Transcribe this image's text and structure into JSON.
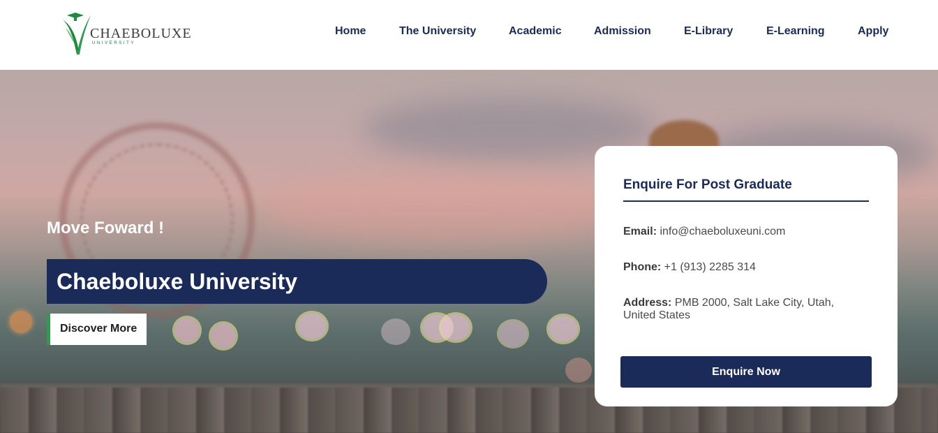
{
  "brand": {
    "name": "CHAEBOLUXE",
    "tagline": "UNIVERSITY",
    "primary_color": "#1b2b59",
    "accent_color": "#2e9b4f"
  },
  "nav": {
    "items": [
      {
        "label": "Home"
      },
      {
        "label": "The University"
      },
      {
        "label": "Academic"
      },
      {
        "label": "Admission"
      },
      {
        "label": "E-Library"
      },
      {
        "label": "E-Learning"
      },
      {
        "label": "Apply"
      }
    ]
  },
  "hero": {
    "eyebrow": "Move Foward !",
    "title": "Chaeboluxe University",
    "cta_label": "Discover More"
  },
  "enquiry": {
    "title": "Enquire For Post Graduate",
    "email_label": "Email:",
    "email_value": "info@chaeboluxeuni.com",
    "phone_label": "Phone:",
    "phone_value": "+1 (913) 2285 314",
    "address_label": "Address:",
    "address_value": "PMB 2000, Salt Lake City, Utah, United States",
    "button_label": "Enquire Now"
  }
}
